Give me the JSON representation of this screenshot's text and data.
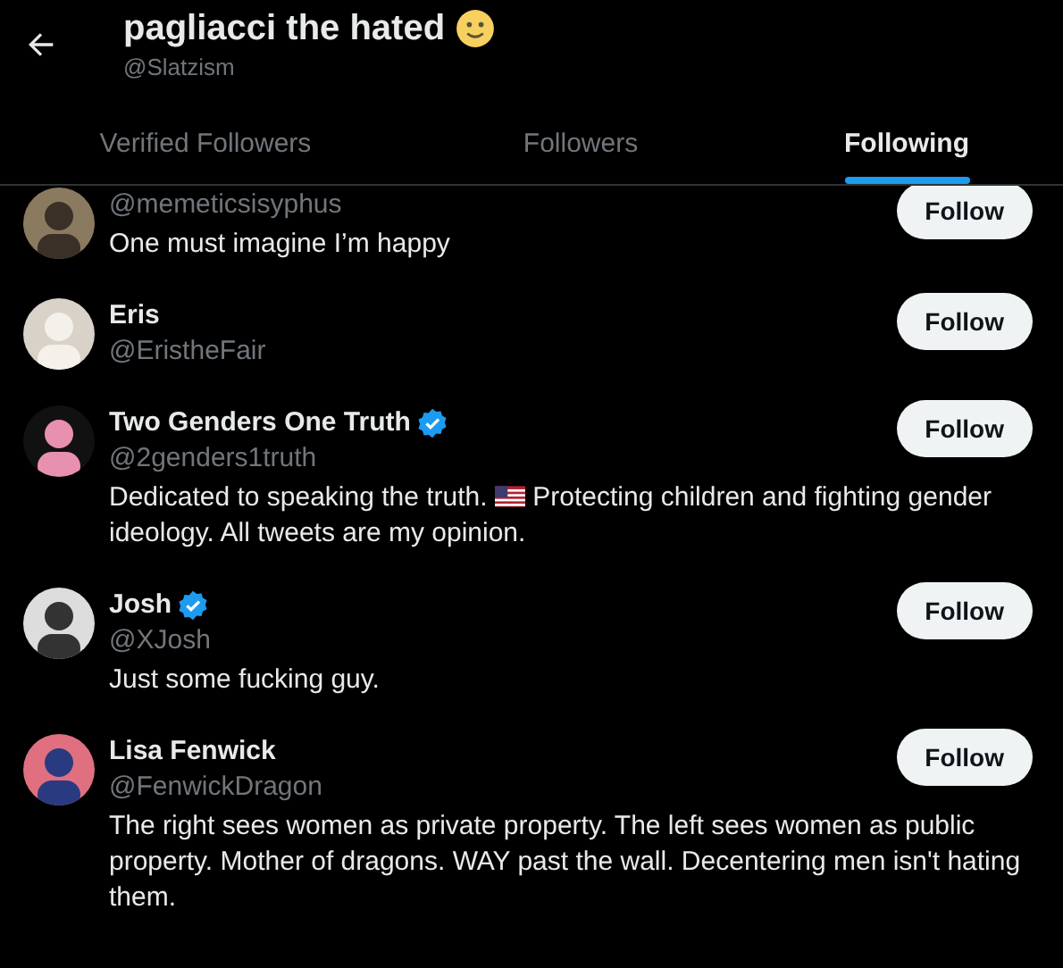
{
  "header": {
    "title": "pagliacci the hated",
    "handle": "@Slatzism"
  },
  "tabs": [
    {
      "label": "Verified Followers",
      "selected": false
    },
    {
      "label": "Followers",
      "selected": false
    },
    {
      "label": "Following",
      "selected": true
    }
  ],
  "users": [
    {
      "handle": "@memeticsisyphus",
      "bio": [
        {
          "kind": "text",
          "text": "One must imagine I’m happy"
        }
      ],
      "button": "Follow"
    },
    {
      "name": "Eris",
      "handle": "@EristheFair",
      "verified": false,
      "button": "Follow"
    },
    {
      "name": "Two Genders One Truth",
      "handle": "@2genders1truth",
      "verified": true,
      "bio": [
        {
          "kind": "text",
          "text": "Dedicated to speaking the truth."
        },
        {
          "kind": "flag"
        },
        {
          "kind": "text",
          "text": "Protecting children and fighting gender"
        },
        {
          "kind": "text",
          "text": "ideology. All tweets are my opinion."
        }
      ],
      "button": "Follow"
    },
    {
      "name": "Josh",
      "handle": "@XJosh",
      "verified": true,
      "bio": [
        {
          "kind": "text",
          "text": "Just some fucking guy."
        }
      ],
      "button": "Follow"
    },
    {
      "name": "Lisa Fenwick",
      "handle": "@FenwickDragon",
      "verified": false,
      "bio": [
        {
          "kind": "text",
          "text": "The right sees women as private property. The left sees women as public property. Mother of dragons. WAY past the wall. Decentering men isn't hating them."
        }
      ],
      "button": "Follow"
    }
  ]
}
